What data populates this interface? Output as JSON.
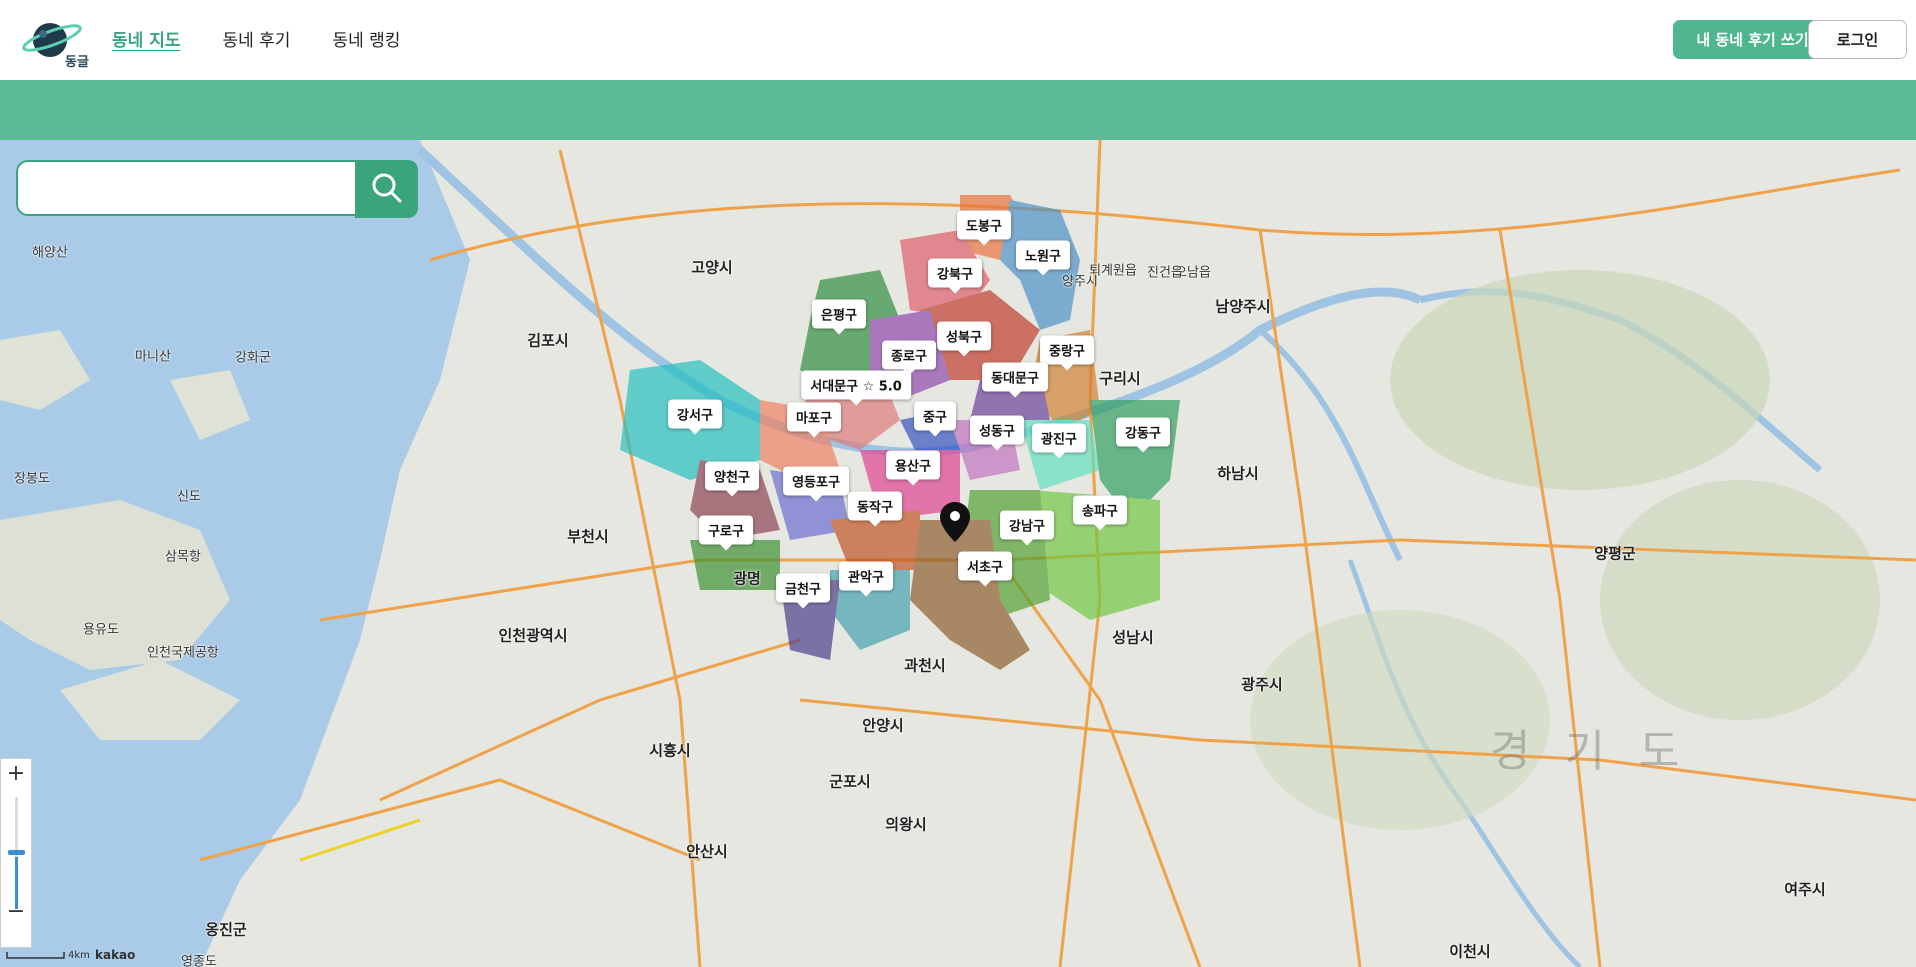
{
  "header": {
    "logo_text": "동글",
    "nav": [
      {
        "label": "동네 지도",
        "active": true
      },
      {
        "label": "동네 후기",
        "active": false
      },
      {
        "label": "동네 랭킹",
        "active": false
      }
    ],
    "write_button": "내 동네 후기 쓰기",
    "login_button": "로그인"
  },
  "colors": {
    "accent": "#3aa57d",
    "band": "#5bbb96",
    "write_button": "#4fb690"
  },
  "search": {
    "placeholder": "",
    "icon": "search-icon"
  },
  "districts": [
    {
      "name": "도봉구",
      "color": "#e8703a"
    },
    {
      "name": "노원구",
      "color": "#4a90c8"
    },
    {
      "name": "강북구",
      "color": "#e05a6a"
    },
    {
      "name": "은평구",
      "color": "#2e8b3e"
    },
    {
      "name": "성북구",
      "color": "#c0392b"
    },
    {
      "name": "종로구",
      "color": "#8e44ad"
    },
    {
      "name": "중랑구",
      "color": "#d08030"
    },
    {
      "name": "서대문구 ☆ 5.0",
      "color": "#e07a7a"
    },
    {
      "name": "동대문구",
      "color": "#6a3d9a"
    },
    {
      "name": "강서구",
      "color": "#20c0c0"
    },
    {
      "name": "마포구",
      "color": "#f08060"
    },
    {
      "name": "중구",
      "color": "#3050c0"
    },
    {
      "name": "성동구",
      "color": "#c070c0"
    },
    {
      "name": "광진구",
      "color": "#60e0c0"
    },
    {
      "name": "강동구",
      "color": "#2e9e5e"
    },
    {
      "name": "양천구",
      "color": "#8b4050"
    },
    {
      "name": "영등포구",
      "color": "#6a6ad0"
    },
    {
      "name": "용산구",
      "color": "#e04090"
    },
    {
      "name": "동작구",
      "color": "#c05020"
    },
    {
      "name": "송파구",
      "color": "#70c840"
    },
    {
      "name": "구로구",
      "color": "#3a9030"
    },
    {
      "name": "강남구",
      "color": "#50a030"
    },
    {
      "name": "서초구",
      "color": "#8b5a2b"
    },
    {
      "name": "관악구",
      "color": "#40a0b0"
    },
    {
      "name": "금천구",
      "color": "#4a3a8a"
    }
  ],
  "map_places": [
    "고양시",
    "김포시",
    "남양주시",
    "구리시",
    "하남시",
    "부천시",
    "인천광역시",
    "광명",
    "과천시",
    "성남시",
    "광주시",
    "안양시",
    "시흥시",
    "군포시",
    "의왕시",
    "안산시",
    "양평군",
    "이천시",
    "여주시",
    "옹진군",
    "인천국제공항",
    "용유도",
    "영종도",
    "신도",
    "장봉도",
    "마니산",
    "강화군",
    "삼목항",
    "해양산",
    "오남읍",
    "진건읍",
    "퇴계원읍",
    "양주시"
  ],
  "watermark": "경 기 도",
  "zoom": {
    "in": "+",
    "out": "−",
    "level_fraction": 0.46
  },
  "scale_label": "4km",
  "attribution": "kakao"
}
